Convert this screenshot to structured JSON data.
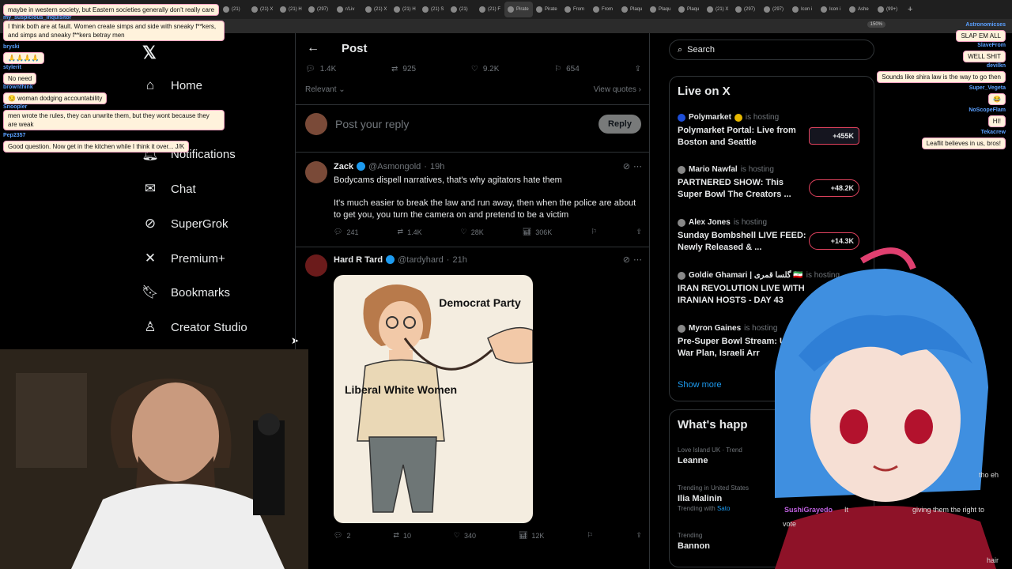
{
  "browser": {
    "tabs": [
      "(21)",
      "(21) X",
      "(21) H",
      "(297)",
      "r/Liv",
      "(21) X",
      "(21) H",
      "(21) S",
      "(21)",
      "(21) F",
      "Pirate",
      "Pirate",
      "From",
      "From",
      "Plaqu",
      "Plaqu",
      "Plaqu",
      "(21) X",
      "(297)",
      "(297)",
      "Icon i",
      "Icon i",
      "Ashe",
      "(99+)"
    ],
    "zoom": "150%"
  },
  "nav": {
    "items": [
      {
        "label": "Home",
        "icon": "home-icon"
      },
      {
        "label": "Notifications",
        "icon": "bell-icon"
      },
      {
        "label": "Chat",
        "icon": "mail-icon"
      },
      {
        "label": "SuperGrok",
        "icon": "grok-icon"
      },
      {
        "label": "Premium+",
        "icon": "x-icon"
      },
      {
        "label": "Bookmarks",
        "icon": "bookmark-icon"
      },
      {
        "label": "Creator Studio",
        "icon": "creator-icon"
      }
    ]
  },
  "post": {
    "title": "Post",
    "stats": {
      "replies": "1.4K",
      "reposts": "925",
      "likes": "9.2K",
      "bookmarks": "654"
    },
    "sort": "Relevant",
    "view_quotes": "View quotes",
    "reply_placeholder": "Post your reply",
    "reply_button": "Reply"
  },
  "tweets": [
    {
      "name": "Zack",
      "handle": "@Asmongold",
      "time": "19h",
      "quote_line": "Bodycams dispell narratives, that's why agitators hate them",
      "text": "It's much easier to break the law and run away, then when the police are about to get you, you turn the camera on and pretend to be a victim",
      "replies": "241",
      "reposts": "1.4K",
      "likes": "28K",
      "views": "306K"
    },
    {
      "name": "Hard R Tard",
      "handle": "@tardyhard",
      "time": "21h",
      "image_label_1": "Democrat Party",
      "image_label_2": "Liberal White Women",
      "replies": "2",
      "reposts": "10",
      "likes": "340",
      "views": "12K"
    }
  ],
  "right": {
    "search_placeholder": "Search",
    "live_title": "Live on X",
    "hosting_label": "is hosting",
    "live": [
      {
        "host": "Polymarket",
        "title": "Polymarket Portal: Live from Boston and Seattle",
        "count": "+455K"
      },
      {
        "host": "Mario Nawfal",
        "title": "PARTNERED SHOW: This Super Bowl The Creators ...",
        "count": "+48.2K"
      },
      {
        "host": "Alex Jones",
        "title": "Sunday Bombshell LIVE FEED: Newly Released & ...",
        "count": "+14.3K"
      },
      {
        "host": "Goldie Ghamari | گلسا قمری 🇮🇷",
        "title": "IRAN REVOLUTION LIVE WITH IRANIAN HOSTS - DAY 43",
        "count": ""
      },
      {
        "host": "Myron Gaines",
        "title": "Pre-Super Bowl Stream: U Iran War Plan, Israeli Arr",
        "count": ""
      }
    ],
    "show_more": "Show more",
    "happening_title": "What's happ",
    "trends": [
      {
        "context": "Love Island UK · Trend",
        "name": "Leanne",
        "with": ""
      },
      {
        "context": "Trending in United States",
        "name": "Ilia Malinin",
        "with": "Sato"
      },
      {
        "context": "Trending",
        "name": "Bannon",
        "with": ""
      }
    ],
    "trending_with_label": "Trending with"
  },
  "chat_left": [
    {
      "user": "",
      "text": "maybe in western society, but Eastern societies generally don't really care"
    },
    {
      "user": "my_suspicious_inquisitor",
      "text": "I think both are at fault. Women create simps and side with sneaky f**kers, and simps and sneaky f**kers betray men"
    },
    {
      "user": "bryski",
      "text": "🙏🙏🙏🙏"
    },
    {
      "user": "stylerit",
      "text": "No need"
    },
    {
      "user": "brownthink",
      "text": "😏 woman dodging accountability"
    },
    {
      "user": "Snoopler",
      "text": "men wrote the rules, they can unwrite them, but they wont because they are weak"
    },
    {
      "user": "Pep2357",
      "text": "Good question. Now get in the kitchen while I think it over... J/K"
    }
  ],
  "chat_right": [
    {
      "user": "Astronomicses",
      "text": "SLAP EM ALL"
    },
    {
      "user": "SlaveFrom",
      "text": "WELL SHIT"
    },
    {
      "user": "devilkn",
      "text": "Sounds like shira law is the way to go then"
    },
    {
      "user": "Super_Vegeta",
      "text": "😂"
    },
    {
      "user": "NoScopeFlam",
      "text": "HI!"
    },
    {
      "user": "Tekacrew",
      "text": "Leaflit believes in us, bros!"
    }
  ],
  "overlay_bits": {
    "tho_eh": "tho eh",
    "sushi_user": "SushiGrayedo",
    "sushi_text": "It",
    "giving": "giving them the right to",
    "vote": "vote",
    "hair": "hair"
  }
}
